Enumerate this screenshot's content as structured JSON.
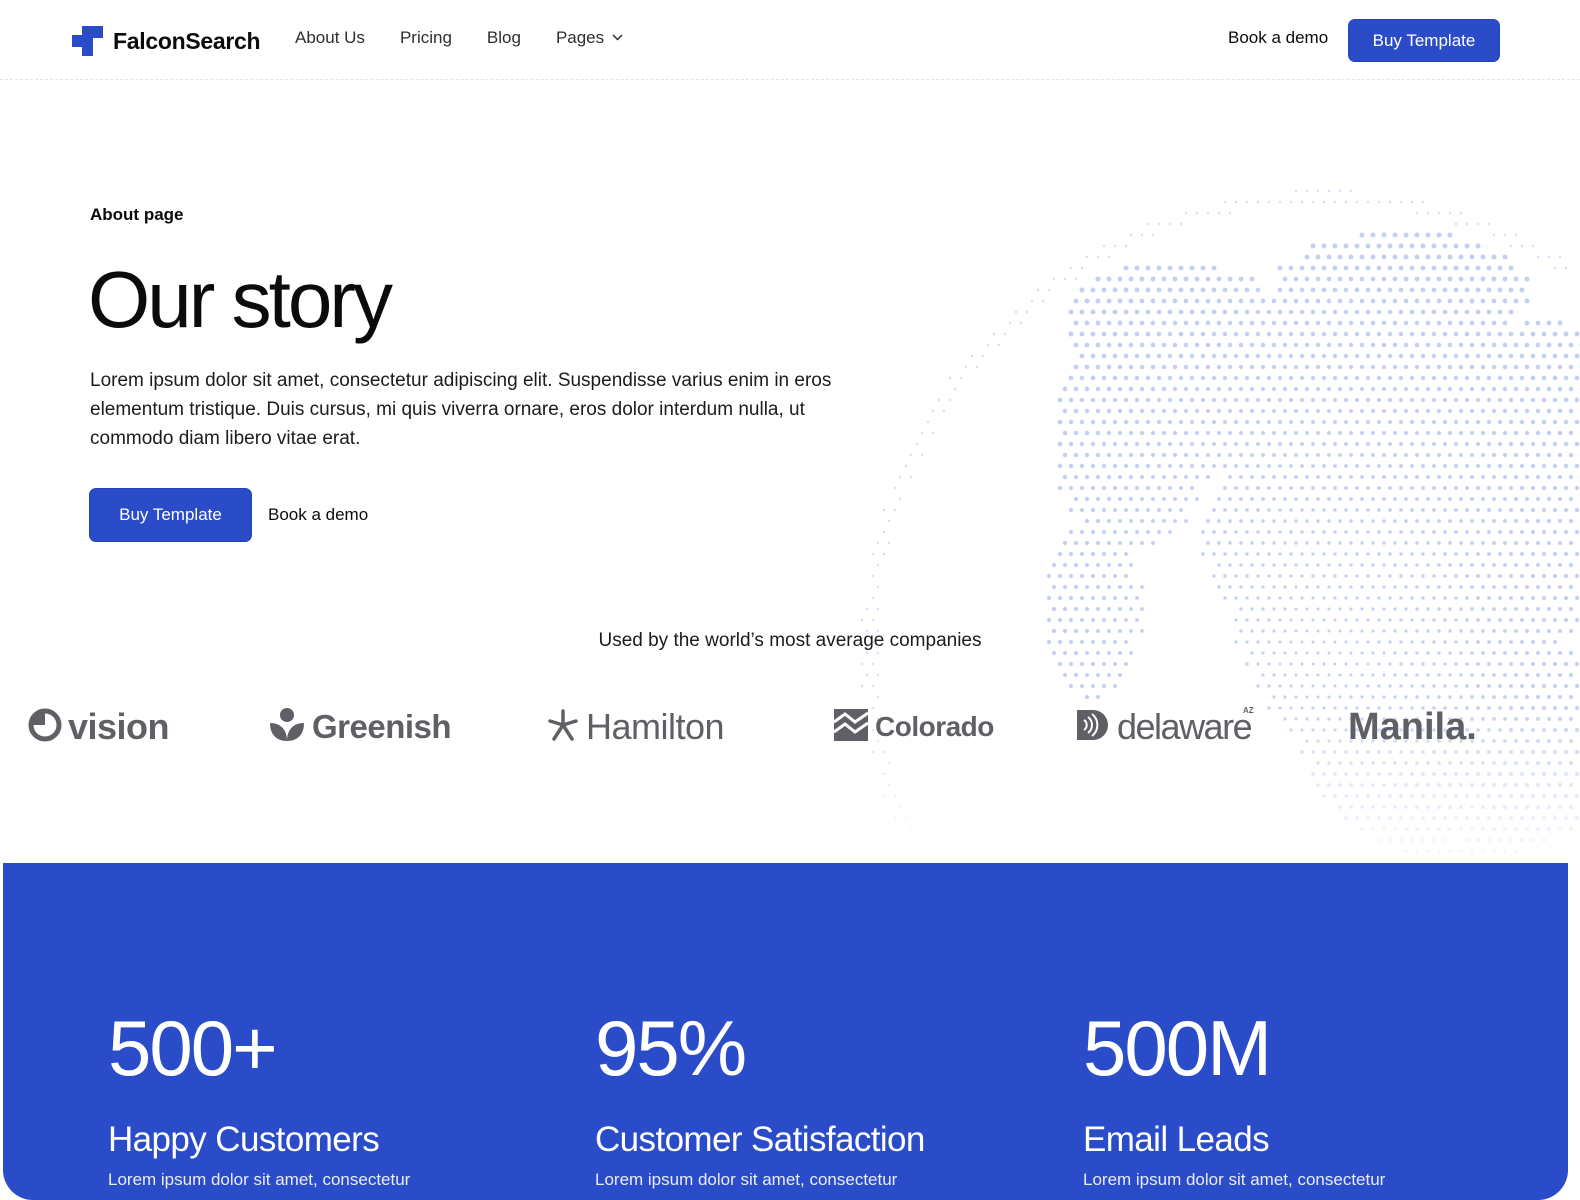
{
  "brand": {
    "name": "FalconSearch",
    "accent": "#2a4cc8"
  },
  "nav": {
    "links": [
      {
        "label": "About Us"
      },
      {
        "label": "Pricing"
      },
      {
        "label": "Blog"
      },
      {
        "label": "Pages"
      }
    ],
    "demo_label": "Book a demo",
    "buy_label": "Buy Template"
  },
  "hero": {
    "eyebrow": "About page",
    "title": "Our story",
    "text": "Lorem ipsum dolor sit amet, consectetur adipiscing elit. Suspendisse varius enim in eros elementum tristique. Duis cursus, mi quis viverra ornare, eros dolor interdum nulla, ut commodo diam libero vitae erat.",
    "buy_label": "Buy Template",
    "demo_label": "Book a demo"
  },
  "logos": {
    "caption": "Used by the world’s most average companies",
    "items": [
      {
        "name": "vision",
        "icon": "vision-icon"
      },
      {
        "name": "Greenish",
        "icon": "leaf-icon"
      },
      {
        "name": "Hamilton",
        "icon": "asterisk-icon"
      },
      {
        "name": "Colorado",
        "icon": "mountain-icon"
      },
      {
        "name": "delaware",
        "icon": "sound-wave-icon",
        "superscript": "AZ"
      },
      {
        "name": "Manila.",
        "icon": ""
      }
    ]
  },
  "stats": [
    {
      "value": "500+",
      "label": "Happy Customers",
      "desc": "Lorem ipsum dolor sit amet, consectetur"
    },
    {
      "value": "95%",
      "label": "Customer Satisfaction",
      "desc": "Lorem ipsum dolor sit amet, consectetur"
    },
    {
      "value": "500M",
      "label": "Email Leads",
      "desc": "Lorem ipsum dolor sit amet, consectetur"
    }
  ]
}
